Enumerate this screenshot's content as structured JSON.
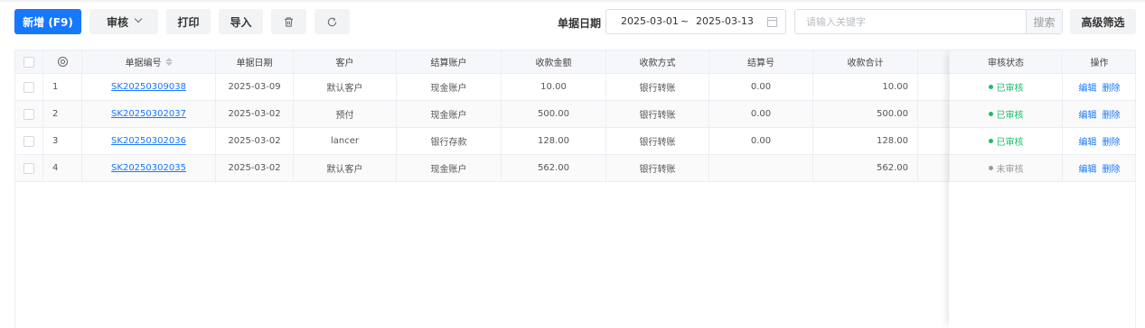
{
  "toolbar": {
    "new_label": "新增 (F9)",
    "audit_label": "审核",
    "print_label": "打印",
    "import_label": "导入",
    "date_label": "单据日期",
    "date_start": "2025-03-01",
    "date_sep": "~",
    "date_end": "2025-03-13",
    "search_placeholder": "请输入关键字",
    "search_value": "",
    "search_label": "搜索",
    "advanced_label": "高级筛选"
  },
  "table": {
    "columns": [
      "单据编号",
      "单据日期",
      "客户",
      "结算账户",
      "收款金额",
      "收款方式",
      "结算号",
      "收款合计",
      "审核状态",
      "操作"
    ],
    "rows": [
      {
        "index": "1",
        "code": "SK20250309038",
        "date": "2025-03-09",
        "customer": "默认客户",
        "account": "现金账户",
        "amount": "10.00",
        "method": "银行转账",
        "settle_no": "0.00",
        "total": "10.00",
        "status": "已审核",
        "status_color": "#19be6b"
      },
      {
        "index": "2",
        "code": "SK20250302037",
        "date": "2025-03-02",
        "customer": "预付",
        "account": "现金账户",
        "amount": "500.00",
        "method": "银行转账",
        "settle_no": "0.00",
        "total": "500.00",
        "status": "已审核",
        "status_color": "#19be6b"
      },
      {
        "index": "3",
        "code": "SK20250302036",
        "date": "2025-03-02",
        "customer": "lancer",
        "account": "银行存款",
        "amount": "128.00",
        "method": "银行转账",
        "settle_no": "0.00",
        "total": "128.00",
        "status": "已审核",
        "status_color": "#19be6b"
      },
      {
        "index": "4",
        "code": "SK20250302035",
        "date": "2025-03-02",
        "customer": "默认客户",
        "account": "现金账户",
        "amount": "562.00",
        "method": "银行转账",
        "settle_no": "",
        "total": "562.00",
        "status": "未审核",
        "status_color": "#999999"
      }
    ],
    "actions": {
      "edit": "编辑",
      "delete": "删除"
    }
  },
  "colors": {
    "primary": "#1677ff",
    "approved": "#19be6b",
    "pending": "#999999"
  },
  "icons": {
    "delete": "trash-icon",
    "refresh": "refresh-icon",
    "settings": "gear-icon",
    "calendar": "calendar-icon"
  }
}
